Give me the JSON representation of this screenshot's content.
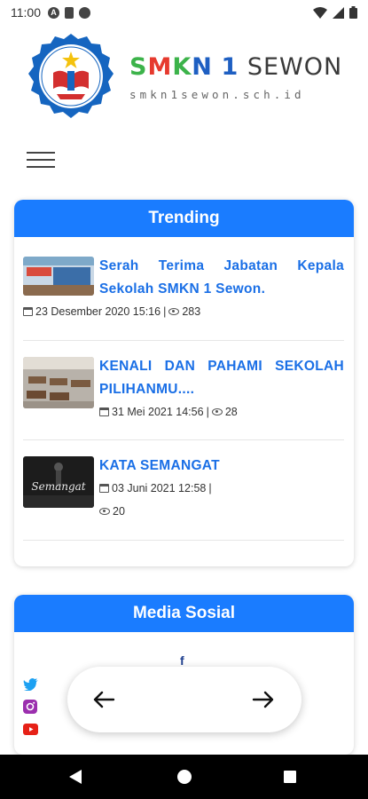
{
  "status_bar": {
    "time": "11:00"
  },
  "brand": {
    "title_parts": [
      "S",
      "M",
      "K",
      "N",
      "1",
      "SEWON"
    ],
    "url": "smkn1sewon.sch.id"
  },
  "trending": {
    "heading": "Trending",
    "items": [
      {
        "title": "Serah Terima Jabatan Kepala Sekolah SMKN 1 Sewon.",
        "date": "23 Desember 2020 15:16",
        "separator": "|",
        "views": "283"
      },
      {
        "title": "KENALI DAN PAHAMI SEKOLAH PILIHANMU....",
        "date": "31 Mei 2021 14:56",
        "separator": "|",
        "views": "28"
      },
      {
        "title": "KATA SEMANGAT",
        "date": "03 Juni 2021 12:58",
        "separator": "|",
        "views": "20"
      }
    ]
  },
  "social": {
    "heading": "Media Sosial",
    "icons": [
      "facebook-icon",
      "twitter-icon",
      "instagram-icon",
      "youtube-icon"
    ],
    "facebook_glyph": "f"
  },
  "colors": {
    "accent": "#1a7cff",
    "title_link": "#1a6fe6"
  },
  "icons": {
    "prev": "arrow-left-icon",
    "next": "arrow-right-icon"
  }
}
